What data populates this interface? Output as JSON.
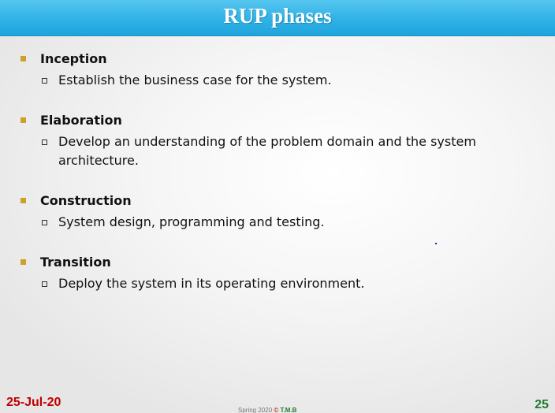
{
  "slide": {
    "title": "RUP phases",
    "phases": [
      {
        "name": "Inception",
        "description": "Establish the business case for the system."
      },
      {
        "name": "Elaboration",
        "description": "Develop an understanding of the problem domain and the system architecture."
      },
      {
        "name": "Construction",
        "description": "System design, programming and testing."
      },
      {
        "name": "Transition",
        "description": "Deploy the system in its operating environment."
      }
    ]
  },
  "footer": {
    "date": "25-Jul-20",
    "page_number": "25",
    "note_prefix": "Spring 2020",
    "note_symbol": "©",
    "note_author": "T.M.B"
  },
  "colors": {
    "title_bar": "#2fb2e6",
    "bullet_level1": "#c9a227",
    "date": "#c00000",
    "page_number": "#1e7d32"
  }
}
